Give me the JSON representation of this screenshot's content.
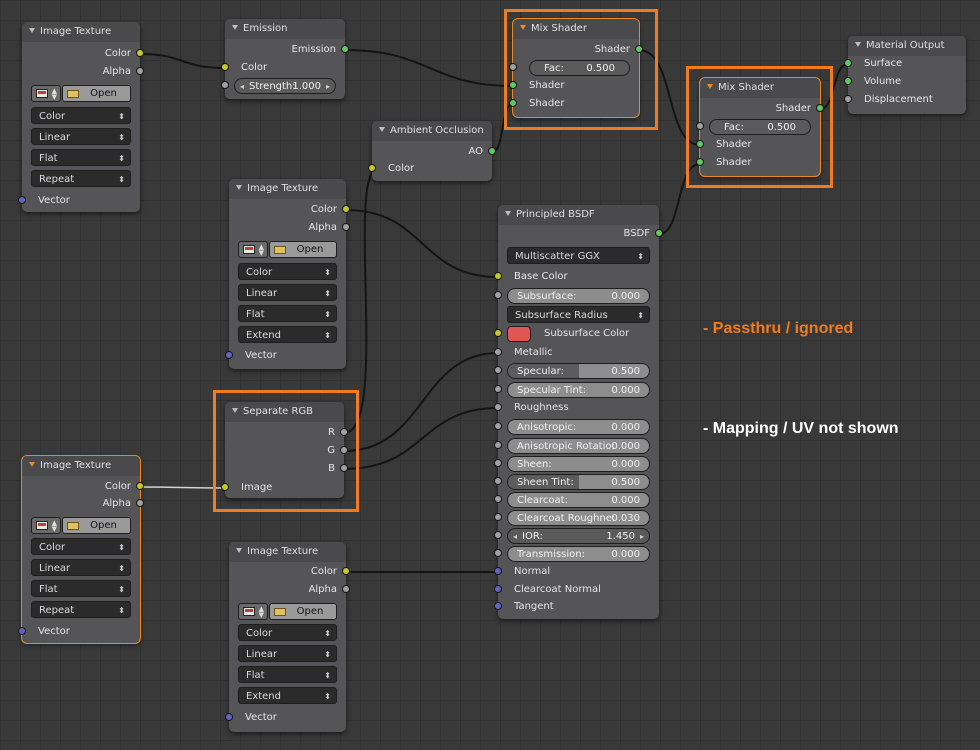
{
  "socket_colors": {
    "color": "#c7c729",
    "shader": "#63c763",
    "value": "#a1a1a1",
    "vector": "#6363c7"
  },
  "highlight_color": "#f07c22",
  "icons": [
    "collapse-triangle-icon",
    "image-browse-icon",
    "folder-icon",
    "updown-arrows-icon",
    "left-right-arrows-icon"
  ],
  "tex1": {
    "title": "Image Texture",
    "out_color": "Color",
    "out_alpha": "Alpha",
    "open": "Open",
    "color_mode": "Color",
    "interpolation": "Linear",
    "projection": "Flat",
    "extension": "Repeat",
    "in_vector": "Vector"
  },
  "emission": {
    "title": "Emission",
    "out": "Emission",
    "in_color": "Color",
    "strength_label": "Strength:",
    "strength_value": "1.000"
  },
  "mix1": {
    "title": "Mix Shader",
    "out": "Shader",
    "fac_label": "Fac:",
    "fac_value": "0.500",
    "in1": "Shader",
    "in2": "Shader"
  },
  "output": {
    "title": "Material Output",
    "surface": "Surface",
    "volume": "Volume",
    "displacement": "Displacement"
  },
  "mix2": {
    "title": "Mix Shader",
    "out": "Shader",
    "fac_label": "Fac:",
    "fac_value": "0.500",
    "in1": "Shader",
    "in2": "Shader"
  },
  "ao": {
    "title": "Ambient Occlusion",
    "out": "AO",
    "in_color": "Color"
  },
  "tex2": {
    "title": "Image Texture",
    "out_color": "Color",
    "out_alpha": "Alpha",
    "open": "Open",
    "color_mode": "Color",
    "interpolation": "Linear",
    "projection": "Flat",
    "extension": "Extend",
    "in_vector": "Vector"
  },
  "bsdf": {
    "title": "Principled BSDF",
    "out": "BSDF",
    "distribution": "Multiscatter GGX",
    "base_color": "Base Color",
    "subsurface_label": "Subsurface:",
    "subsurface_value": "0.000",
    "subsurface_method": "Subsurface Radius",
    "subsurface_color_label": "Subsurface Color",
    "subsurface_color": "#e05656",
    "metallic": "Metallic",
    "specular_label": "Specular:",
    "specular_value": "0.500",
    "specular_fraction": 0.5,
    "specular_tint_label": "Specular Tint:",
    "specular_tint_value": "0.000",
    "roughness": "Roughness",
    "anisotropic_label": "Anisotropic:",
    "anisotropic_value": "0.000",
    "aniso_rotation_label": "Anisotropic Rotatio:",
    "aniso_rotation_value": "0.000",
    "sheen_label": "Sheen:",
    "sheen_value": "0.000",
    "sheen_tint_label": "Sheen Tint:",
    "sheen_tint_value": "0.500",
    "sheen_tint_fraction": 0.5,
    "clearcoat_label": "Clearcoat:",
    "clearcoat_value": "0.000",
    "clearcoat_rough_label": "Clearcoat Roughne:",
    "clearcoat_rough_value": "0.030",
    "ior_label": "IOR:",
    "ior_value": "1.450",
    "transmission_label": "Transmission:",
    "transmission_value": "0.000",
    "normal": "Normal",
    "clearcoat_normal": "Clearcoat Normal",
    "tangent": "Tangent"
  },
  "sep": {
    "title": "Separate RGB",
    "r": "R",
    "g": "G",
    "b": "B",
    "image": "Image"
  },
  "tex3": {
    "title": "Image Texture",
    "out_color": "Color",
    "out_alpha": "Alpha",
    "open": "Open",
    "color_mode": "Color",
    "interpolation": "Linear",
    "projection": "Flat",
    "extension": "Repeat",
    "in_vector": "Vector"
  },
  "tex4": {
    "title": "Image Texture",
    "out_color": "Color",
    "out_alpha": "Alpha",
    "open": "Open",
    "color_mode": "Color",
    "interpolation": "Linear",
    "projection": "Flat",
    "extension": "Extend",
    "in_vector": "Vector"
  },
  "notes": {
    "passthru": "- Passthru / ignored",
    "mapping": "- Mapping / UV not shown"
  }
}
